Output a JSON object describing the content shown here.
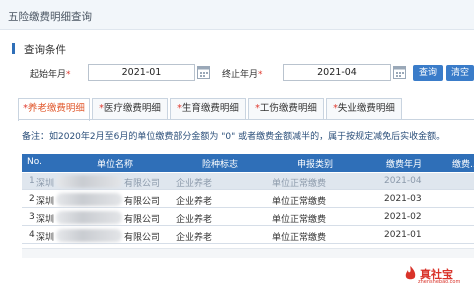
{
  "window": {
    "title": "五险缴费明细查询"
  },
  "query": {
    "section_title": "查询条件",
    "start_label": "起始年月",
    "start_value": "2021-01",
    "end_label": "终止年月",
    "end_value": "2021-04",
    "required_mark": "*",
    "search_button": "查询",
    "clear_button": "清空"
  },
  "tabs": [
    {
      "label": "养老缴费明细",
      "active": true
    },
    {
      "label": "医疗缴费明细",
      "active": false
    },
    {
      "label": "生育缴费明细",
      "active": false
    },
    {
      "label": "工伤缴费明细",
      "active": false
    },
    {
      "label": "失业缴费明细",
      "active": false
    }
  ],
  "note": "备注：如2020年2月至6月的单位缴费部分金额为 \"0\" 或者缴费金额减半的，属于按规定减免后实收金额。",
  "table": {
    "columns": [
      "No.",
      "单位名称",
      "险种标志",
      "申报类别",
      "缴费年月",
      "缴费..."
    ],
    "rows": [
      {
        "no": "1",
        "unit_prefix": "深圳",
        "unit_suffix": "有限公司",
        "insurance": "企业养老",
        "category": "单位正常缴费",
        "month": "2021-04"
      },
      {
        "no": "2",
        "unit_prefix": "深圳",
        "unit_suffix": "有限公司",
        "insurance": "企业养老",
        "category": "单位正常缴费",
        "month": "2021-03"
      },
      {
        "no": "3",
        "unit_prefix": "深圳",
        "unit_suffix": "有限公司",
        "insurance": "企业养老",
        "category": "单位正常缴费",
        "month": "2021-02"
      },
      {
        "no": "4",
        "unit_prefix": "深圳",
        "unit_suffix": "有限公司",
        "insurance": "企业养老",
        "category": "单位正常缴费",
        "month": "2021-01"
      }
    ]
  },
  "watermark": {
    "brand": "真社宝",
    "sub": "zhenshebao.com"
  },
  "colors": {
    "accent": "#2f6fb8",
    "button": "#3a7cc9",
    "required": "#e03a2f",
    "active_tab": "#e0572b"
  }
}
